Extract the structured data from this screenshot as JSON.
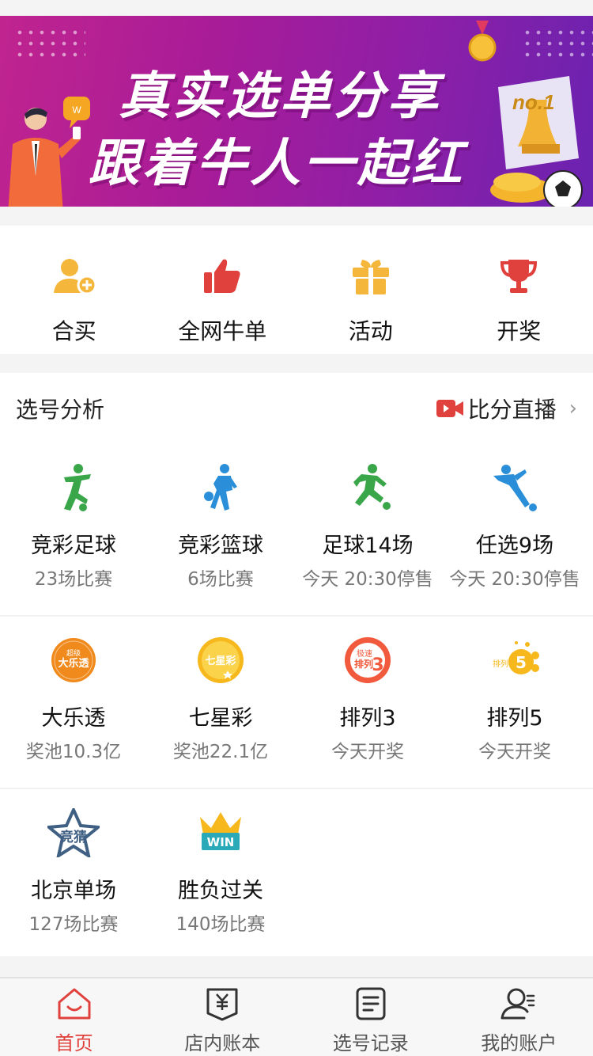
{
  "banner": {
    "headline": "真实选单分享",
    "subline": "跟着牛人一起红",
    "badge_text": "no.1"
  },
  "quick_menu": [
    {
      "label": "合买",
      "icon": "add-user-icon"
    },
    {
      "label": "全网牛单",
      "icon": "thumbs-up-icon"
    },
    {
      "label": "活动",
      "icon": "gift-icon"
    },
    {
      "label": "开奖",
      "icon": "trophy-icon"
    }
  ],
  "analysis": {
    "title": "选号分析",
    "live_label": "比分直播",
    "rows": [
      [
        {
          "name": "竞彩足球",
          "sub": "23场比赛",
          "icon": "soccer-player-icon"
        },
        {
          "name": "竞彩篮球",
          "sub": "6场比赛",
          "icon": "basketball-player-icon"
        },
        {
          "name": "足球14场",
          "sub": "今天 20:30停售",
          "icon": "running-kick-icon"
        },
        {
          "name": "任选9场",
          "sub": "今天 20:30停售",
          "icon": "sliding-tackle-icon"
        }
      ],
      [
        {
          "name": "大乐透",
          "sub": "奖池10.3亿",
          "icon": "daletou-logo-icon",
          "logo_text": "超级大乐透"
        },
        {
          "name": "七星彩",
          "sub": "奖池22.1亿",
          "icon": "qixingcai-logo-icon",
          "logo_text": "七星彩"
        },
        {
          "name": "排列3",
          "sub": "今天开奖",
          "icon": "pailie3-logo-icon",
          "logo_text": "极速排列3"
        },
        {
          "name": "排列5",
          "sub": "今天开奖",
          "icon": "pailie5-logo-icon",
          "logo_text": "排列5"
        }
      ],
      [
        {
          "name": "北京单场",
          "sub": "127场比赛",
          "icon": "jingcai-star-icon",
          "logo_text": "竞猜"
        },
        {
          "name": "胜负过关",
          "sub": "140场比赛",
          "icon": "win-crown-icon",
          "logo_text": "WIN"
        }
      ]
    ]
  },
  "tabbar": [
    {
      "label": "首页",
      "icon": "home-icon",
      "active": true
    },
    {
      "label": "店内账本",
      "icon": "ledger-icon",
      "active": false
    },
    {
      "label": "选号记录",
      "icon": "record-icon",
      "active": false
    },
    {
      "label": "我的账户",
      "icon": "account-icon",
      "active": false
    }
  ],
  "colors": {
    "accent": "#e0413c",
    "gold": "#f5b73b",
    "green": "#3aa64a",
    "blue": "#2a8fd8",
    "orange": "#f08a1c"
  }
}
